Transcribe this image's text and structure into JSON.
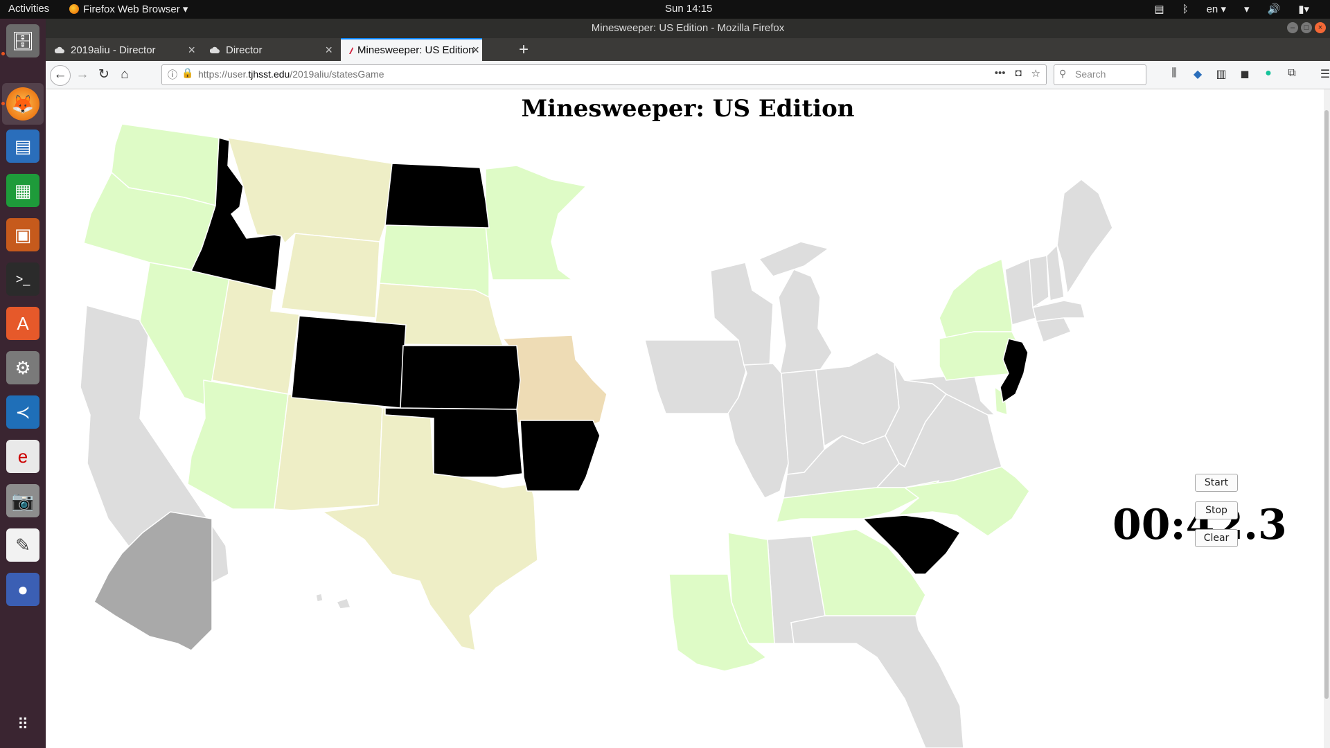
{
  "system": {
    "activities": "Activities",
    "app_menu": "Firefox Web Browser ▾",
    "clock": "Sun 14:15",
    "language": "en ▾"
  },
  "window": {
    "title": "Minesweeper: US Edition - Mozilla Firefox"
  },
  "tabs": [
    {
      "label": "2019aliu - Director"
    },
    {
      "label": "Director"
    },
    {
      "label": "Minesweeper: US Edition"
    }
  ],
  "navbar": {
    "url_prefix": "https://user.",
    "url_domain": "tjhsst.edu",
    "url_path": "/2019aliu/statesGame",
    "search_placeholder": "Search"
  },
  "page": {
    "title": "Minesweeper: US Edition",
    "timer": "00:42.3",
    "buttons": {
      "start": "Start",
      "stop": "Stop",
      "clear": "Clear"
    }
  },
  "colors": {
    "safe_green": "#defbc6",
    "number_tan": "#eeeec6",
    "warning_orange": "#eedcb5",
    "mine_black": "#000000",
    "unrevealed_gray": "#dddddd",
    "alaska_gray": "#a9a9a9"
  },
  "map_states": {
    "revealed_safe": [
      "WA",
      "OR",
      "NV",
      "AZ",
      "SD",
      "MN",
      "NY",
      "PA",
      "TN",
      "NC",
      "GA",
      "MS",
      "LA",
      "DE"
    ],
    "revealed_number": [
      "MT",
      "WY",
      "UT",
      "NM",
      "NE",
      "TX"
    ],
    "revealed_warning": [
      "MO"
    ],
    "mines": [
      "ID",
      "ND",
      "CO",
      "KS",
      "OK",
      "AR",
      "SC",
      "NJ"
    ],
    "unrevealed": [
      "CA",
      "IA",
      "WI",
      "IL",
      "MI",
      "IN",
      "OH",
      "KY",
      "WV",
      "VA",
      "MD",
      "AL",
      "FL",
      "ME",
      "VT",
      "NH",
      "MA",
      "CT",
      "RI",
      "HI"
    ],
    "alaska": [
      "AK"
    ]
  }
}
